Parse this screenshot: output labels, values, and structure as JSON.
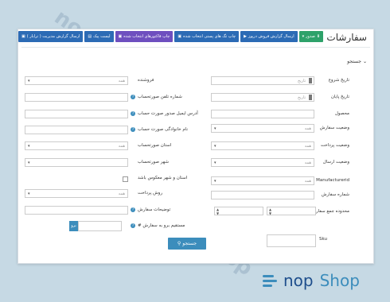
{
  "page": {
    "title": "سفارشات",
    "background": "#c6d9e4",
    "watermark": "nopshop"
  },
  "toolbar": {
    "export_label": "صدور",
    "export_dropdown": "▾",
    "buttons": [
      {
        "label": "ارسال گزارش فروش درپوز",
        "color": "#2c6bb5"
      },
      {
        "label": "چاپ تگ های پستی انتخاب شده",
        "color": "#2c6bb5"
      },
      {
        "label": "چاپ فاکتورهای انتخاب شده",
        "color": "#6e4fbf"
      },
      {
        "label": "لیست پیک",
        "color": "#2c6bb5"
      },
      {
        "label": "ارسال گزارش مدیریت ( ترابار )",
        "color": "#2c6bb5"
      }
    ],
    "export_color": "#2ea26a"
  },
  "search": {
    "heading": "جستجو",
    "submit_label": "جستجو",
    "right": {
      "start_date": {
        "label": "تاریخ شروع",
        "placeholder": "تاریخ"
      },
      "end_date": {
        "label": "تاریخ پایان",
        "placeholder": "تاریخ"
      },
      "product": {
        "label": "محصول"
      },
      "order_status": {
        "label": "وضعیت سفارش",
        "value": "همه"
      },
      "payment_status": {
        "label": "وضعیت پرداخت",
        "value": "همه"
      },
      "shipping_status": {
        "label": "وضعیت ارسال",
        "value": "همه"
      },
      "manufacturer": {
        "label": "Manufacturerid",
        "value": "همه"
      },
      "order_number": {
        "label": "شماره سفارش"
      },
      "order_total_range": {
        "label": "محدوده جمع سفارش"
      },
      "sku": {
        "label": "Sku"
      }
    },
    "left": {
      "vendor": {
        "label": "فروشنده",
        "value": "همه"
      },
      "billing_phone": {
        "label": "شماره تلفن صورتحساب"
      },
      "billing_email": {
        "label": "آدرس ایمیل صدور صورت حساب"
      },
      "billing_lastname": {
        "label": "نام خانوادگی صورت حساب"
      },
      "billing_country": {
        "label": "استان صورتحساب",
        "value": "همه"
      },
      "billing_city": {
        "label": "شهر صورتحساب"
      },
      "reverse_country_city": {
        "label": "استان و شهر معکوس باشد"
      },
      "payment_method": {
        "label": "روش پرداخت",
        "value": "همه"
      },
      "order_notes": {
        "label": "توضیحات سفارش"
      },
      "goto_order": {
        "label": "مستقیم برو به سفارش #",
        "button": "برو"
      }
    }
  },
  "footer_brand": {
    "word1": "nop",
    "word2": "Shop"
  }
}
